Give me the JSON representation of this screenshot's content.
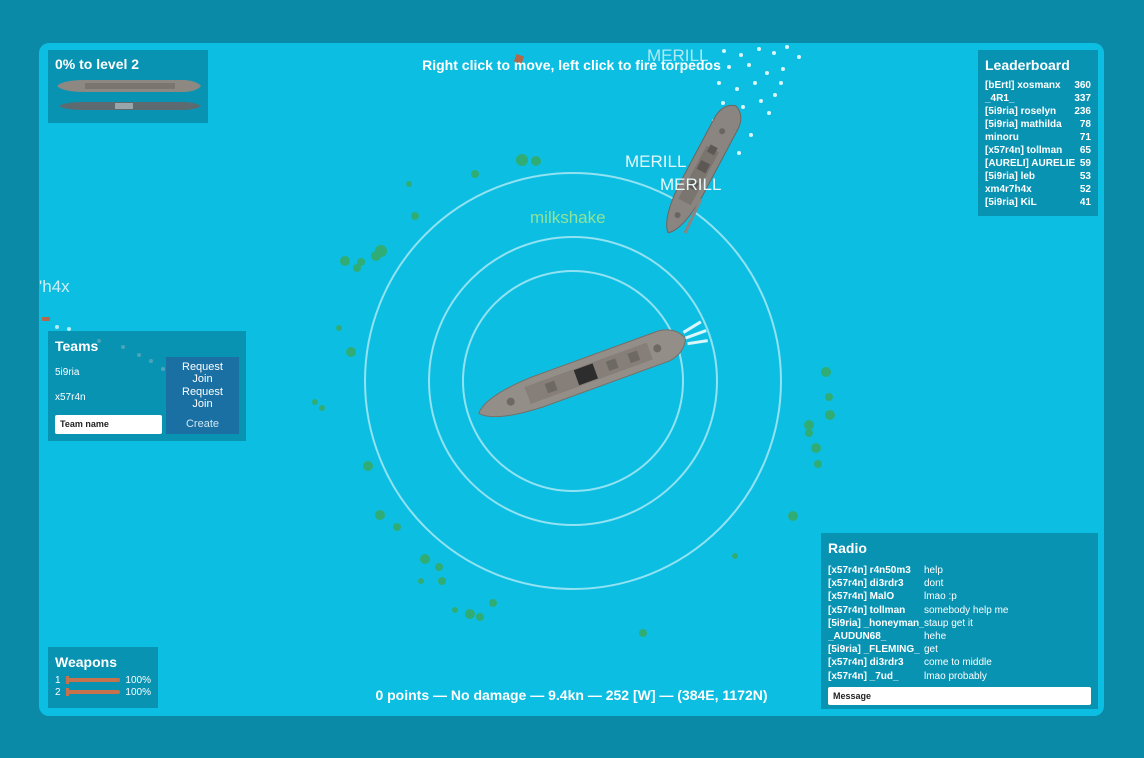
{
  "instructions": "Right click to move, left click to fire torpedos",
  "status": "0 points — No damage — 9.4kn — 252 [W] — (384E, 1172N)",
  "level": {
    "title": "0% to level 2"
  },
  "leaderboard": {
    "title": "Leaderboard",
    "rows": [
      {
        "name": "[bErtl] xosmanx",
        "score": "360"
      },
      {
        "name": "_4R1_",
        "score": "337"
      },
      {
        "name": "[5i9ria] roselyn",
        "score": "236"
      },
      {
        "name": "[5i9ria] mathilda",
        "score": "78"
      },
      {
        "name": "minoru",
        "score": "71"
      },
      {
        "name": "[x57r4n] tollman",
        "score": "65"
      },
      {
        "name": "[AURELI] AURELIE",
        "score": "59"
      },
      {
        "name": "[5i9ria] leb",
        "score": "53"
      },
      {
        "name": "xm4r7h4x",
        "score": "52"
      },
      {
        "name": "[5i9ria] KiL",
        "score": "41"
      }
    ]
  },
  "teams": {
    "title": "Teams",
    "rows": [
      {
        "name": "5i9ria",
        "button": "Request Join"
      },
      {
        "name": "x57r4n",
        "button": "Request Join"
      }
    ],
    "input_placeholder": "Team name",
    "create_label": "Create"
  },
  "weapons": {
    "title": "Weapons",
    "rows": [
      {
        "slot": "1",
        "percent": "100%"
      },
      {
        "slot": "2",
        "percent": "100%"
      }
    ]
  },
  "radio": {
    "title": "Radio",
    "messages": [
      {
        "user": "[x57r4n] r4n50m3",
        "text": "help"
      },
      {
        "user": "[x57r4n] di3rdr3",
        "text": "dont"
      },
      {
        "user": "[x57r4n] MalO",
        "text": "lmao :p"
      },
      {
        "user": "[x57r4n] tollman",
        "text": "somebody help me"
      },
      {
        "user": "[5i9ria] _honeyman_",
        "text": "staup get it"
      },
      {
        "user": "_AUDUN68_",
        "text": "hehe"
      },
      {
        "user": "[5i9ria] _FLEMING_",
        "text": "get"
      },
      {
        "user": "[x57r4n] di3rdr3",
        "text": "come to middle"
      },
      {
        "user": "[x57r4n] _7ud_",
        "text": "lmao probably"
      }
    ],
    "input_placeholder": "Message"
  },
  "labels": {
    "player": "milkshake",
    "enemy1": "MERILL",
    "enemy2": "MERILL",
    "enemy3": "MERILL",
    "offscreen": "'h4x"
  },
  "colors": {
    "background": "#0a8aa6",
    "water": "#0cbfe2",
    "player_label": "#8fe29b",
    "enemy_label": "#e6f7fb"
  }
}
